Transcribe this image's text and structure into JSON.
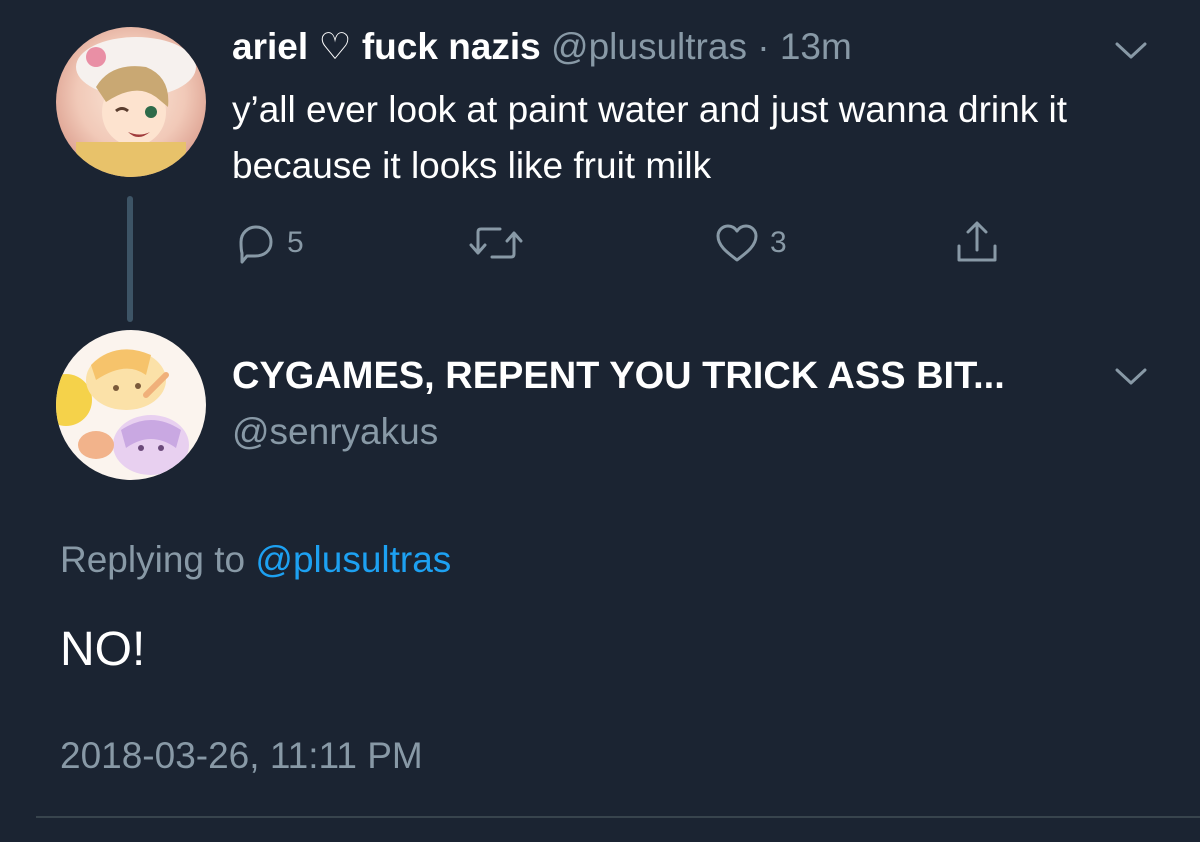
{
  "original_tweet": {
    "display_name": "ariel ♡ fuck nazis",
    "handle": "@plusultras",
    "separator": "·",
    "age": "13m",
    "text": "y’all ever look at paint water and just wanna drink it because it looks like fruit milk",
    "reply_count": "5",
    "like_count": "3",
    "icons": [
      "reply-icon",
      "retweet-icon",
      "like-icon",
      "share-icon",
      "chevron-down-icon"
    ]
  },
  "reply_tweet": {
    "display_name": "CYGAMES, REPENT YOU TRICK ASS BIT...",
    "handle": "@senryakus",
    "replying_prefix": "Replying to",
    "replying_to": "@plusultras",
    "text": "NO!",
    "timestamp": "2018-03-26, 11:11 PM"
  },
  "colors": {
    "background": "#1b2432",
    "text": "#ffffff",
    "secondary": "#8899a6",
    "link": "#1da1f2",
    "thread_line": "#3d5466",
    "divider": "#38444d"
  }
}
